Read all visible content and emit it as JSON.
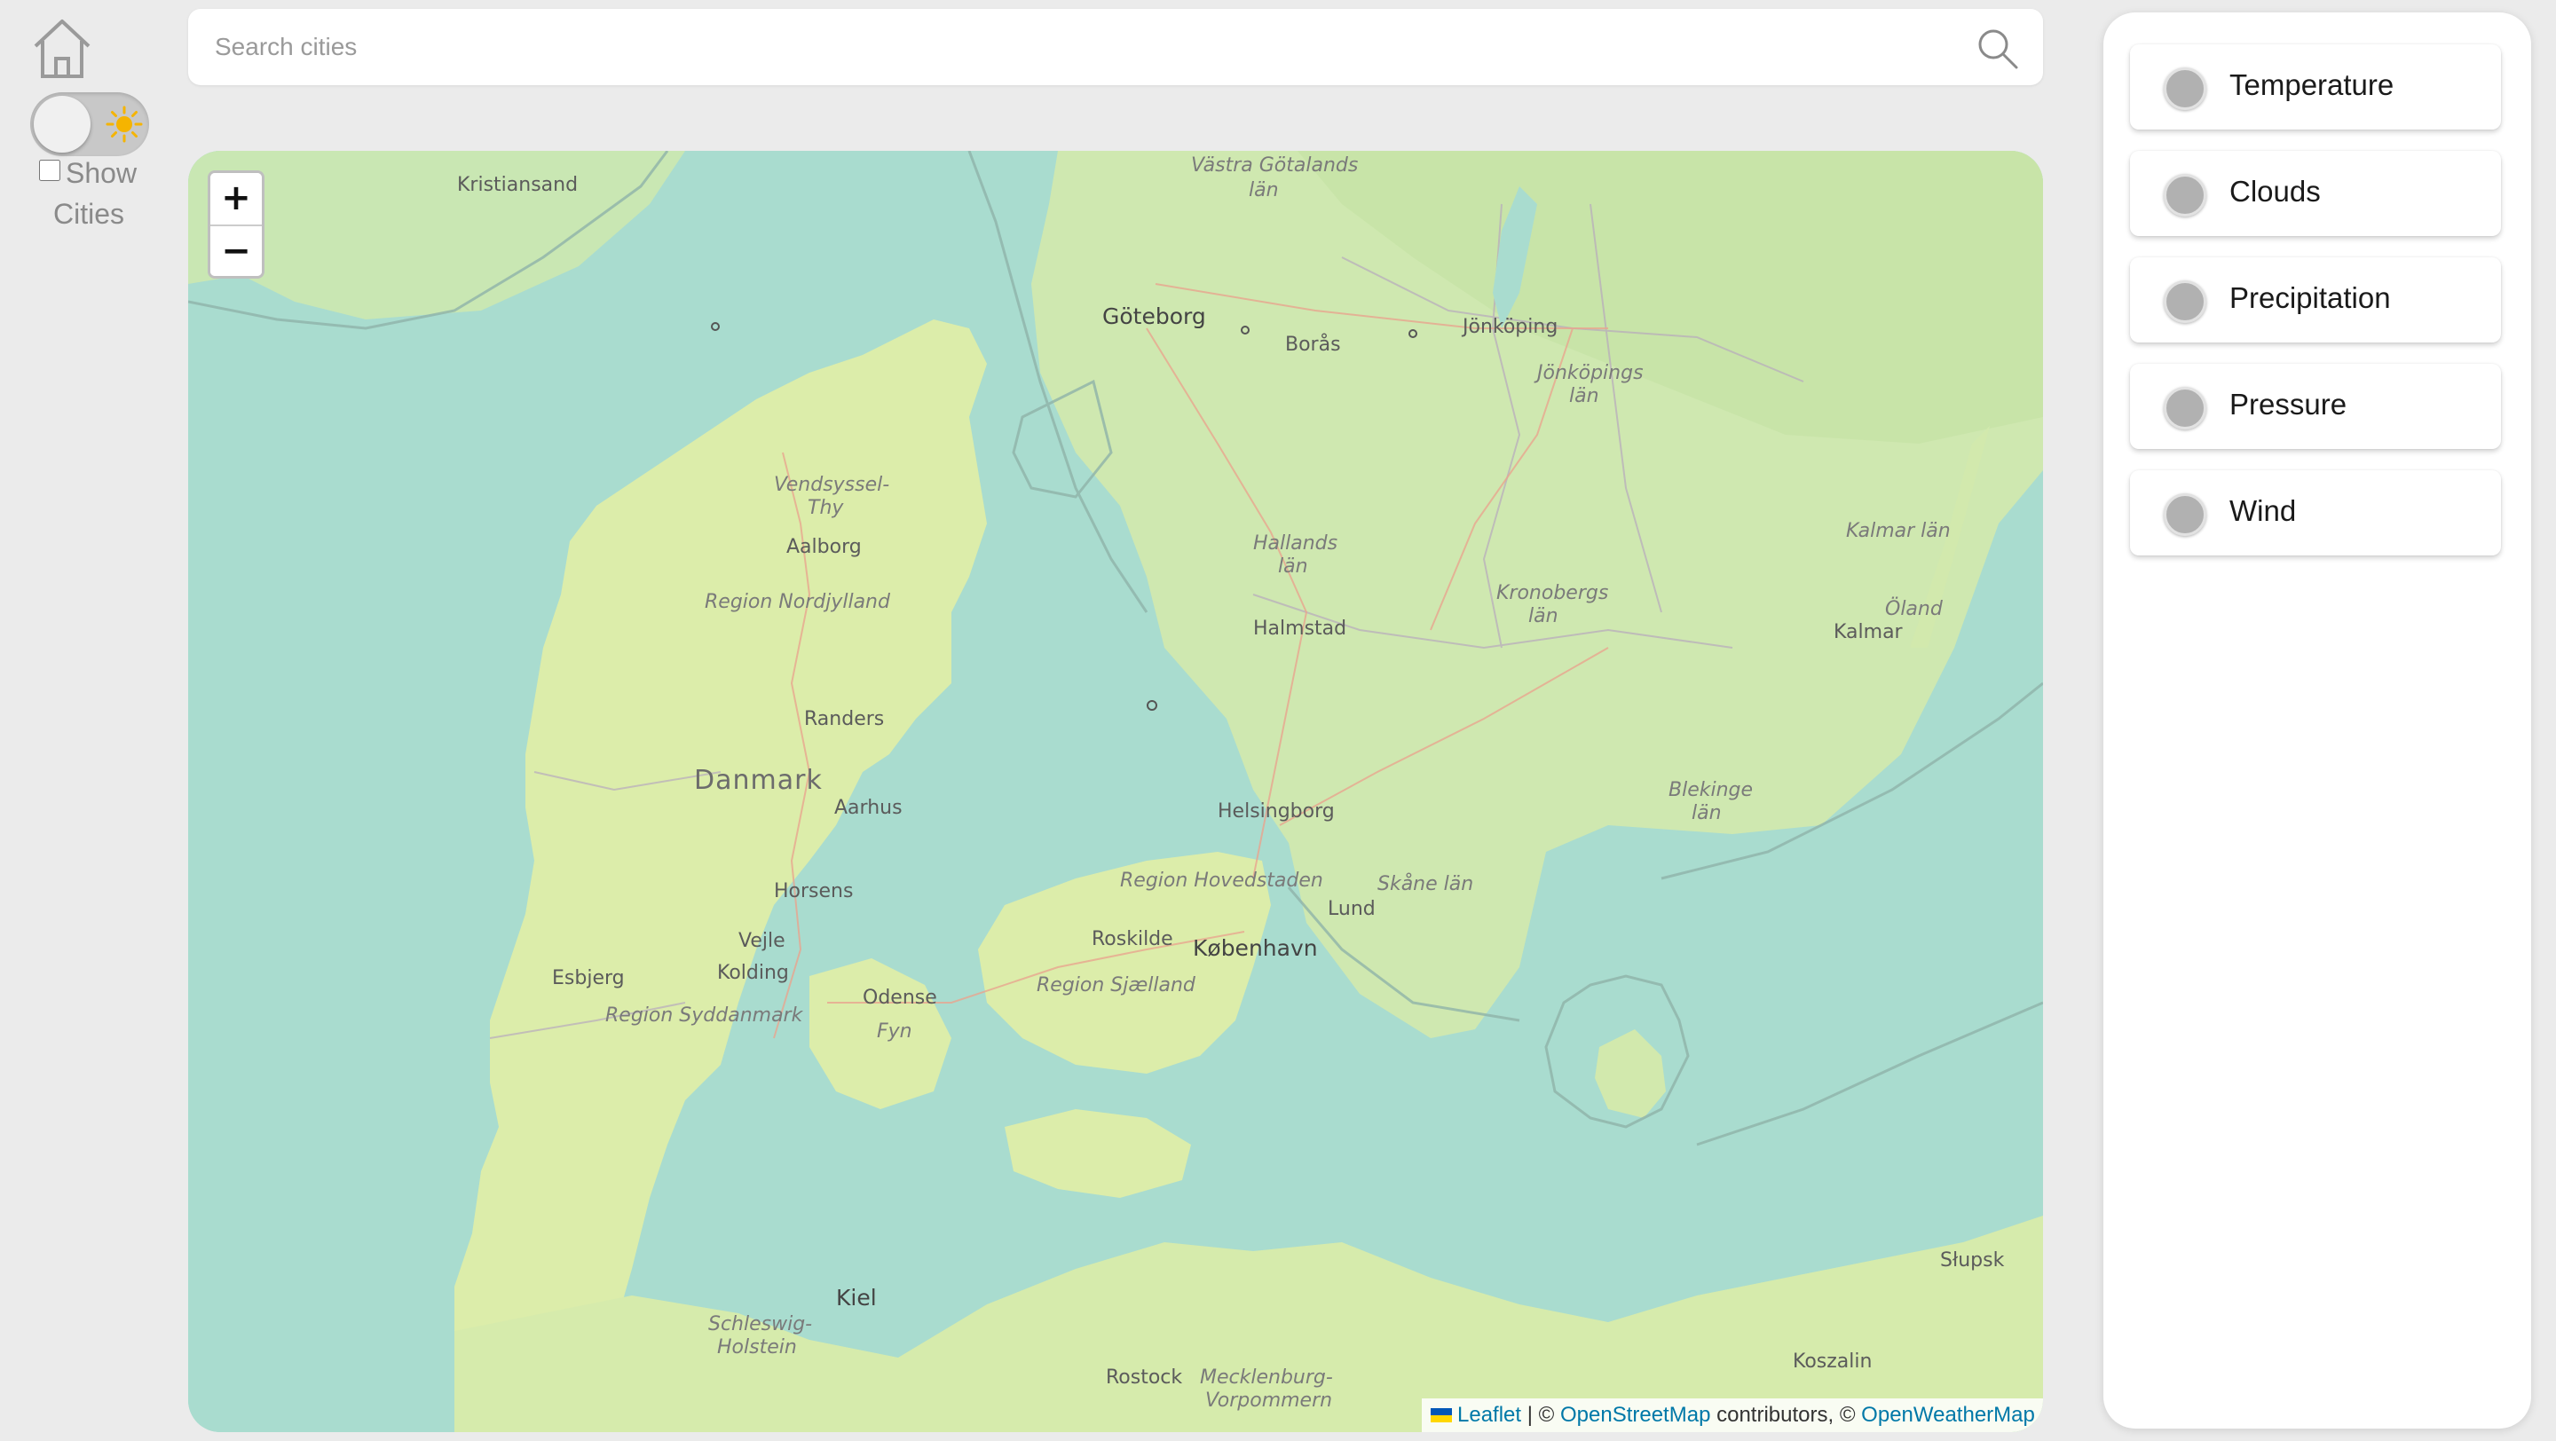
{
  "sidebar": {
    "home_icon": "house-icon",
    "theme_icon": "sun-icon",
    "show_cities_label_1": "Show",
    "show_cities_label_2": "Cities",
    "show_cities_checked": false
  },
  "search": {
    "placeholder": "Search cities",
    "value": "",
    "icon": "magnifier-icon"
  },
  "map": {
    "zoom_in": "+",
    "zoom_out": "−",
    "attribution": {
      "leaflet": "Leaflet",
      "sep": " | © ",
      "osm": "OpenStreetMap",
      "contributors": " contributors, © ",
      "owm": "OpenWeatherMap"
    },
    "labels": {
      "kristiansand": "Kristiansand",
      "vastra_gotalands_1": "Västra Götalands",
      "vastra_gotalands_2": "län",
      "goteborg": "Göteborg",
      "boras": "Borås",
      "jonkoping": "Jönköping",
      "jonkopings_lan_1": "Jönköpings",
      "jonkopings_lan_2": "län",
      "vendsyssel_1": "Vendsyssel-",
      "vendsyssel_2": "Thy",
      "aalborg": "Aalborg",
      "region_nordjylland": "Region Nordjylland",
      "hallands_lan_1": "Hallands",
      "hallands_lan_2": "län",
      "kronobergs_lan_1": "Kronobergs",
      "kronobergs_lan_2": "län",
      "kalmar_lan": "Kalmar län",
      "oland": "Öland",
      "kalmar": "Kalmar",
      "halmstad": "Halmstad",
      "randers": "Randers",
      "danmark": "Danmark",
      "aarhus": "Aarhus",
      "helsingborg": "Helsingborg",
      "blekinge_lan_1": "Blekinge",
      "blekinge_lan_2": "län",
      "region_hovedstaden": "Region Hovedstaden",
      "skane_lan": "Skåne län",
      "horsens": "Horsens",
      "lund": "Lund",
      "roskilde": "Roskilde",
      "kobenhavn": "København",
      "vejle": "Vejle",
      "esbjerg": "Esbjerg",
      "kolding": "Kolding",
      "odense": "Odense",
      "region_sjaelland": "Region Sjælland",
      "region_syddanmark": "Region Syddanmark",
      "fyn": "Fyn",
      "slupsk": "Słupsk",
      "kiel": "Kiel",
      "schleswig_1": "Schleswig-",
      "schleswig_2": "Holstein",
      "koszalin": "Koszalin",
      "rostock": "Rostock",
      "mecklenburg_1": "Mecklenburg-",
      "mecklenburg_2": "Vorpommern"
    }
  },
  "layers": [
    {
      "label": "Temperature"
    },
    {
      "label": "Clouds"
    },
    {
      "label": "Precipitation"
    },
    {
      "label": "Pressure"
    },
    {
      "label": "Wind"
    }
  ]
}
